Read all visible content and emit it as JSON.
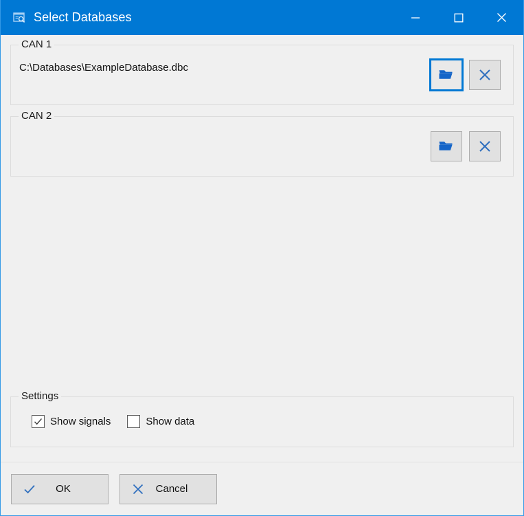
{
  "window": {
    "title": "Select Databases",
    "icon": "database-window-icon",
    "accent_color": "#0078d4",
    "background_color": "#f0f0f0",
    "border_color": "#3399e6"
  },
  "titlebar_buttons": [
    {
      "name": "minimize-button",
      "icon": "minimize-icon",
      "label": "Minimize"
    },
    {
      "name": "maximize-button",
      "icon": "maximize-icon",
      "label": "Maximize"
    },
    {
      "name": "close-button",
      "icon": "close-icon",
      "label": "Close"
    }
  ],
  "groups": {
    "can1": {
      "label": "CAN 1",
      "path": "C:\\Databases\\ExampleDatabase.dbc",
      "browse_icon": "folder-open-icon",
      "clear_icon": "close-x-icon",
      "browse_focused": true
    },
    "can2": {
      "label": "CAN 2",
      "path": "",
      "browse_icon": "folder-open-icon",
      "clear_icon": "close-x-icon",
      "browse_focused": false
    },
    "settings": {
      "label": "Settings",
      "checkboxes": [
        {
          "label": "Show signals",
          "checked": true
        },
        {
          "label": "Show data",
          "checked": false
        }
      ]
    }
  },
  "footer": {
    "ok": {
      "label": "OK",
      "icon": "check-icon"
    },
    "cancel": {
      "label": "Cancel",
      "icon": "x-icon"
    }
  }
}
